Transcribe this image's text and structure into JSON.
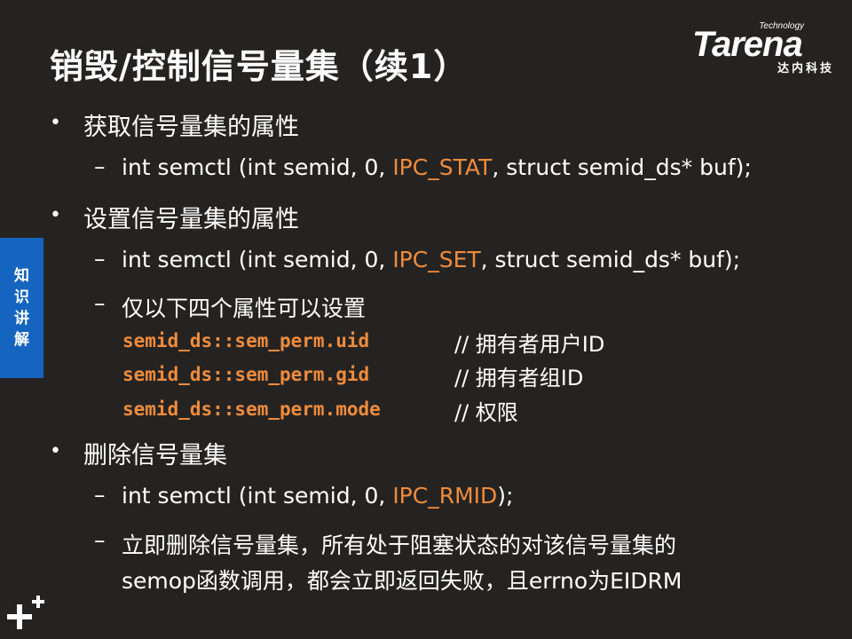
{
  "slide": {
    "title": "销毁/控制信号量集（续1）"
  },
  "logo": {
    "tech": "Technology",
    "name": "Tarena",
    "sub": "达内科技"
  },
  "side_tab": {
    "chars": [
      "知",
      "识",
      "讲",
      "解"
    ]
  },
  "bullets": [
    {
      "text": "获取信号量集的属性",
      "sub": [
        {
          "pre": "int semctl (int semid, 0, ",
          "hl": "IPC_STAT",
          "post": ", struct semid_ds* buf);"
        }
      ]
    },
    {
      "text": "设置信号量集的属性",
      "sub": [
        {
          "pre": "int semctl (int semid, 0, ",
          "hl": "IPC_SET",
          "post": ", struct semid_ds* buf);"
        },
        {
          "text": "仅以下四个属性可以设置"
        }
      ],
      "code_lines": [
        {
          "code": "semid_ds::sem_perm.uid",
          "comment": "// 拥有者用户ID"
        },
        {
          "code": "semid_ds::sem_perm.gid",
          "comment": "// 拥有者组ID"
        },
        {
          "code": "semid_ds::sem_perm.mode",
          "comment": "// 权限"
        }
      ]
    },
    {
      "text": "删除信号量集",
      "sub": [
        {
          "pre": "int semctl (int semid, 0, ",
          "hl": "IPC_RMID",
          "post": ");"
        },
        {
          "line1": "立即删除信号量集，所有处于阻塞状态的对该信号量集的",
          "line2": "semop函数调用，都会立即返回失败，且errno为EIDRM"
        }
      ]
    }
  ],
  "colors": {
    "background": "#252322",
    "highlight": "#f08c3c",
    "side_tab": "#1565c0"
  },
  "icons": {
    "corner": "plus-cluster-icon"
  }
}
